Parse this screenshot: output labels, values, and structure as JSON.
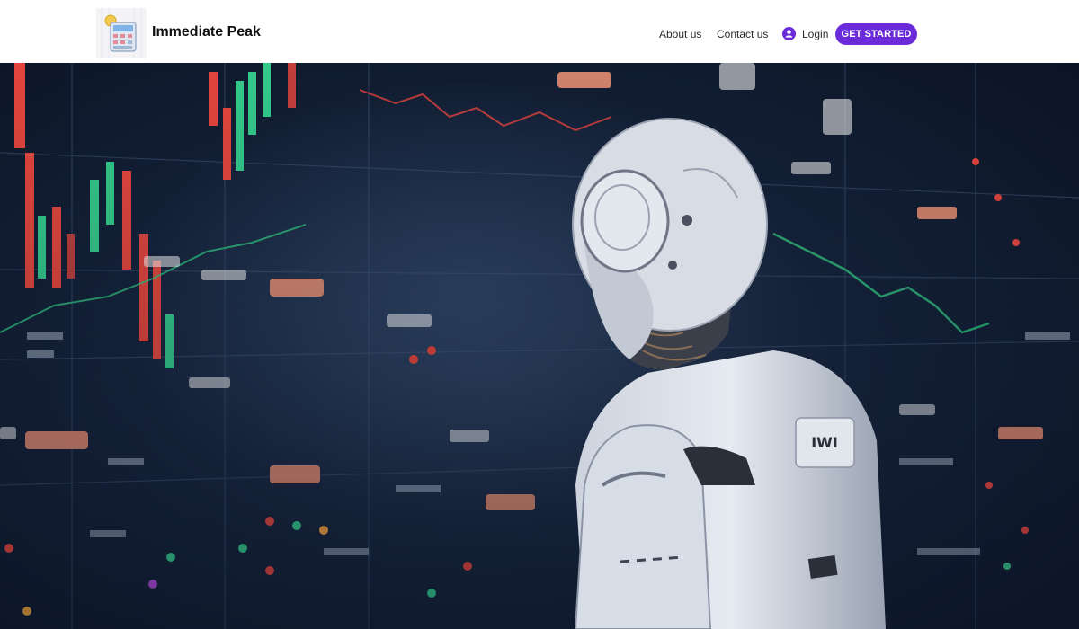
{
  "brand": {
    "name": "Immediate Peak",
    "logo_icon": "calculator-logo-icon"
  },
  "nav": {
    "about": "About us",
    "contact": "Contact us",
    "login": "Login",
    "login_icon": "user-icon",
    "cta": "GET STARTED"
  },
  "hero": {
    "image": "robot-viewing-trading-screens",
    "robot_panel_marking": "IWI"
  },
  "colors": {
    "accent": "#6c2bd9",
    "header_bg": "#ffffff",
    "text": "#2b2b2b",
    "screen_bg": "#15223a",
    "chart_red": "#e2453d",
    "chart_green": "#33c98a"
  }
}
